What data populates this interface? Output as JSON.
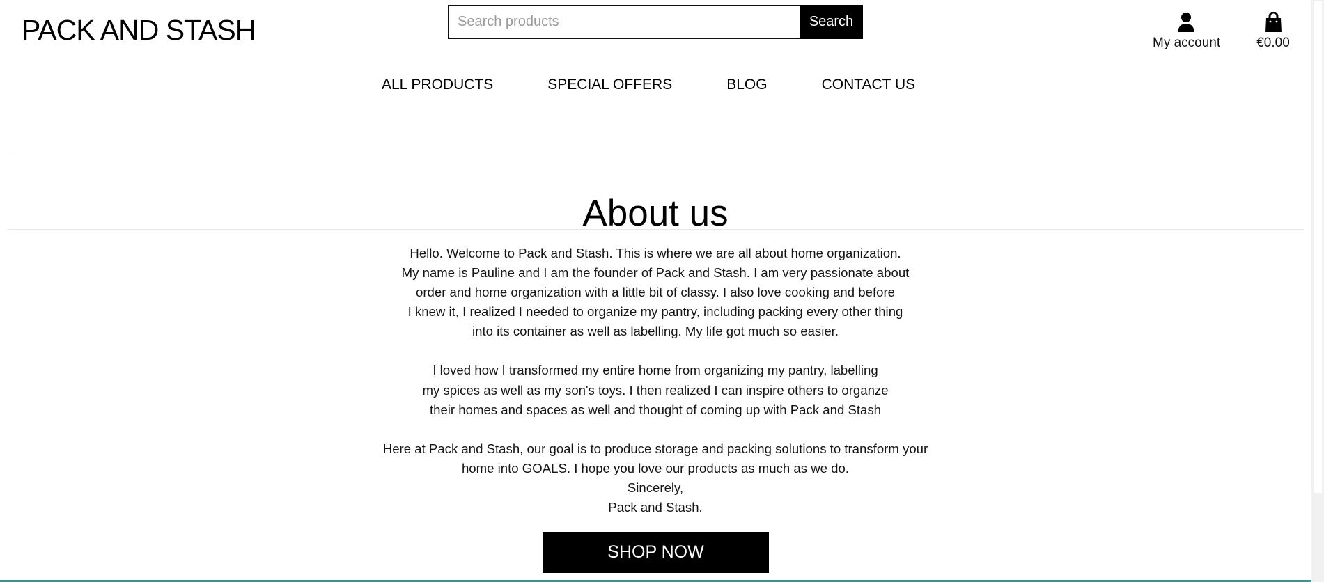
{
  "header": {
    "logo": "PACK AND STASH",
    "search": {
      "placeholder": "Search products",
      "value": "",
      "button": "Search"
    },
    "account": {
      "label": "My account",
      "icon": "user-icon"
    },
    "cart": {
      "total": "€0.00",
      "icon": "shopping-bag-icon"
    }
  },
  "nav": {
    "items": [
      "ALL PRODUCTS",
      "SPECIAL OFFERS",
      "BLOG",
      "CONTACT US"
    ]
  },
  "main": {
    "title": "About us",
    "paragraphs": [
      [
        "Hello. Welcome to Pack and Stash. This is where we are all about home organization.",
        "My name is Pauline and I am the founder of Pack and Stash. I am very passionate about",
        "order and home organization with a little bit of classy. I also love cooking and before",
        "I knew it, I realized I needed to organize my pantry, including packing every other thing",
        "into its container as well as labelling. My life got much so easier."
      ],
      [
        "I loved how I transformed my entire home from organizing my pantry, labelling",
        "my spices as well as my son's toys. I then realized I can inspire others to organze",
        "their homes and spaces as well and thought of coming up with Pack and Stash"
      ],
      [
        "Here at Pack and Stash, our goal is to produce storage and packing solutions to transform your",
        "home into GOALS. I hope you love our products as much as we do.",
        "Sincerely,",
        "Pack and Stash."
      ]
    ],
    "cta": "SHOP NOW"
  },
  "colors": {
    "text": "#111111",
    "button": "#000000",
    "divider": "#e6e6e6",
    "accent_footer": "#3d8f91"
  }
}
